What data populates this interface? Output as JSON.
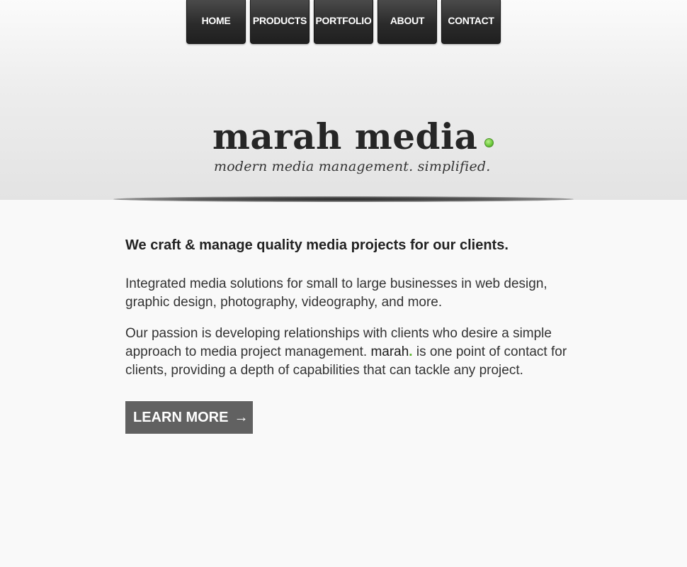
{
  "nav": {
    "items": [
      {
        "label": "HOME"
      },
      {
        "label": "PRODUCTS"
      },
      {
        "label": "PORTFOLIO"
      },
      {
        "label": "ABOUT"
      },
      {
        "label": "CONTACT"
      }
    ]
  },
  "brand": {
    "name": "marah media",
    "tagline": "modern media management. simplified.",
    "dot_color": "#6ac739"
  },
  "main": {
    "lead": "We craft & manage quality media projects for our clients.",
    "para1": "Integrated media solutions for small to large businesses in web design, graphic design, photography, videography, and more.",
    "para2_before": "Our passion is developing relationships with clients who desire a simple approach to media project management. ",
    "para2_brand": "marah",
    "para2_brand_dot": ".",
    "para2_after": " is one point of contact for clients, providing a depth of capabilities that can tackle any project.",
    "cta_label": "LEARN MORE",
    "cta_arrow": "→"
  },
  "colors": {
    "accent_green": "#5ab82e",
    "nav_bg": "#2b2b2b",
    "button_bg": "#616161"
  }
}
